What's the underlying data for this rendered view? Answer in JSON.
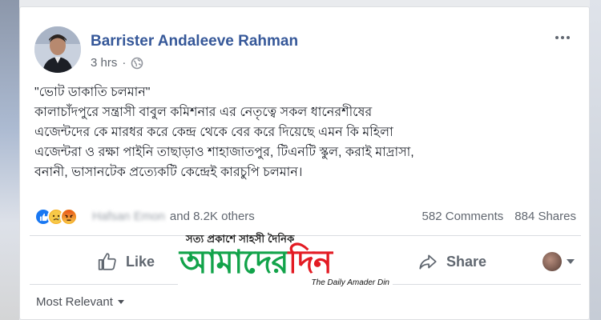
{
  "post": {
    "author": "Barrister Andaleeve Rahman",
    "time": "3 hrs",
    "lines": [
      "\"ভোট ডাকাতি চলমান\"",
      "কালাচাঁদপুরে সন্ত্রাসী বাবুল কমিশনার এর নেতৃত্বে সকল ধানেরশীষের",
      "এজেন্টদের কে মারধর করে কেন্দ্র থেকে বের করে দিয়েছে এমন কি মহিলা",
      "এজেন্টরা ও রক্ষা পাইনি তাছাড়াও শাহাজাতপুর, টিএনটি স্কুল, করাই মাদ্রাসা,",
      "বনানী, ভাসানটেক প্রত্যেকটি কেন্দ্রেই কারচুপি চলমান।"
    ]
  },
  "stats": {
    "reactor_name": "Hafsan Emon",
    "others_text": "and 8.2K others",
    "comments": "582 Comments",
    "shares": "884 Shares"
  },
  "actions": {
    "like": "Like",
    "share": "Share"
  },
  "comments_filter": "Most Relevant",
  "watermark": {
    "tagline": "সত্য প্রকাশে সাহসী দৈনিক",
    "name_green": "আমাদের",
    "name_red": "দিন",
    "subtitle": "The Daily Amader Din"
  },
  "icons": [
    "globe-icon",
    "more-options-icon",
    "like-reaction-icon",
    "sad-reaction-icon",
    "angry-reaction-icon",
    "like-thumb-icon",
    "share-arrow-icon",
    "chevron-down-icon"
  ],
  "colors": {
    "link_blue": "#365899",
    "like_blue": "#1877f2",
    "logo_green": "#12a34a",
    "logo_red": "#e31b23"
  }
}
